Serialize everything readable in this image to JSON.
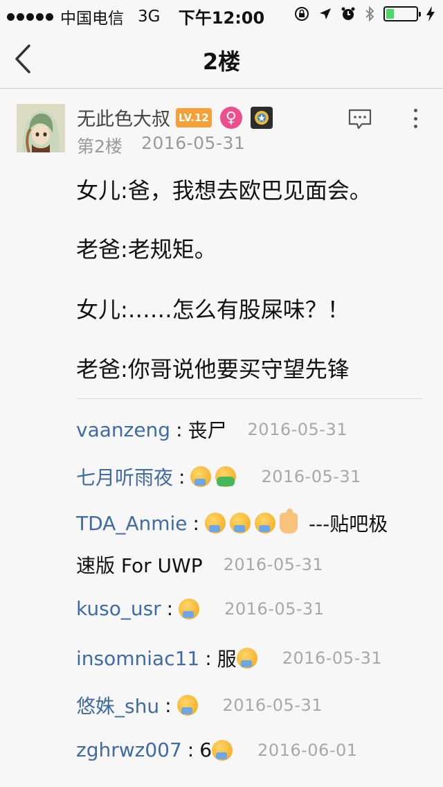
{
  "status_bar": {
    "carrier": "中国电信",
    "network": "3G",
    "time": "下午12:00",
    "battery_level": 0.25
  },
  "nav": {
    "title": "2楼"
  },
  "post": {
    "author": "无此色大叔",
    "level": "LV.12",
    "gender_symbol": "♀",
    "floor": "第2楼",
    "date": "2016-05-31",
    "lines": [
      "女儿:爸，我想去欧巴见面会。",
      "老爸:老规矩。",
      "女儿:……怎么有股屎味？！",
      "老爸:你哥说他要买守望先锋"
    ]
  },
  "comments": [
    {
      "user": "vaanzeng",
      "colon": ":",
      "text": "丧尸",
      "date": "2016-05-31"
    },
    {
      "user": "七月听雨夜",
      "colon": ":",
      "text": "",
      "emojis": [
        "angry-face-emoji",
        "vomit-face-emoji"
      ],
      "date": "2016-05-31"
    },
    {
      "user": "TDA_Anmie",
      "colon": ":",
      "text": "",
      "emojis": [
        "angry-face-emoji",
        "angry-face-emoji",
        "angry-face-emoji",
        "thumbs-up-emoji"
      ],
      "suffix": "---贴吧极",
      "suffix2": "速版 For UWP",
      "date": "2016-05-31"
    },
    {
      "user": "kuso_usr",
      "colon": ":",
      "text": "",
      "emojis": [
        "angry-face-emoji"
      ],
      "date": "2016-05-31"
    },
    {
      "user": "insomniac11",
      "colon": ":",
      "text": "服",
      "emojis": [
        "angry-face-emoji"
      ],
      "date": "2016-05-31"
    },
    {
      "user": "悠姝_shu",
      "colon": ":",
      "text": "",
      "emojis": [
        "angry-face-emoji"
      ],
      "date": "2016-05-31"
    },
    {
      "user": "zghrwz007",
      "colon": ":",
      "text": "6",
      "emojis": [
        "angry-face-emoji"
      ],
      "date": "2016-06-01"
    }
  ]
}
